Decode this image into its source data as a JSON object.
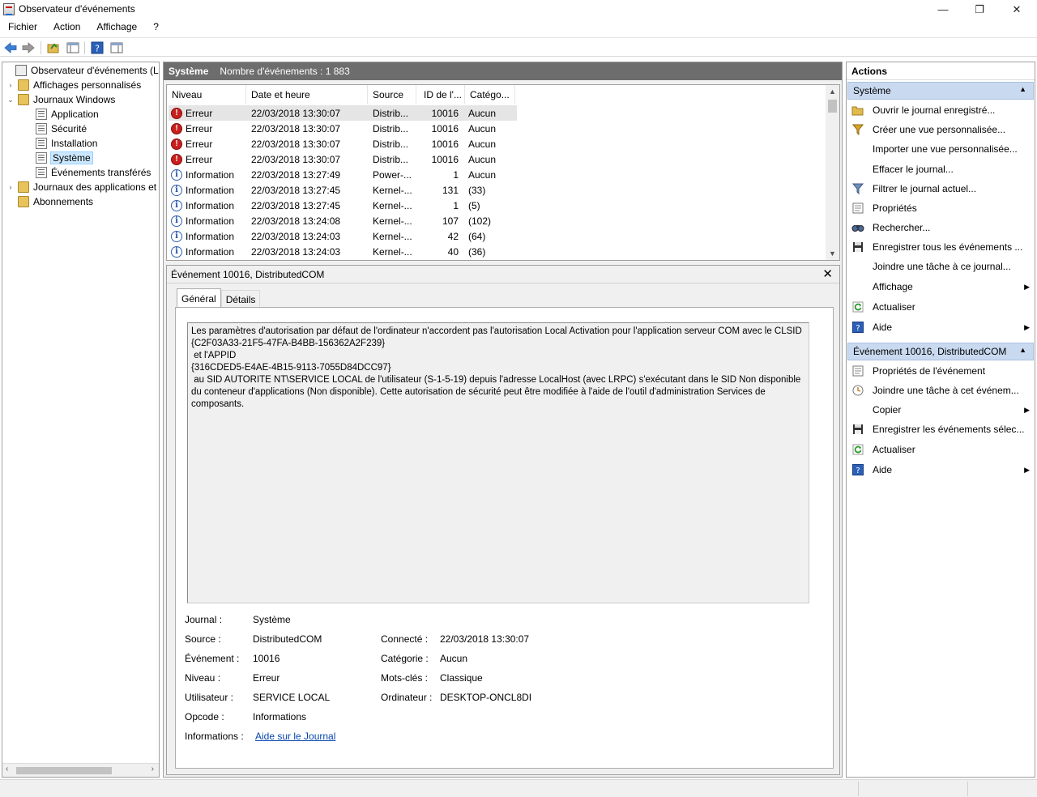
{
  "window": {
    "title": "Observateur d'événements",
    "controls": {
      "minimize": "—",
      "maximize": "❐",
      "close": "✕"
    }
  },
  "menu": [
    "Fichier",
    "Action",
    "Affichage",
    "?"
  ],
  "toolbar": {
    "icons": [
      "back-arrow-icon",
      "forward-arrow-icon",
      "open-folder-icon",
      "console-tree-icon",
      "help-icon",
      "action-pane-icon"
    ]
  },
  "tree": {
    "items": [
      {
        "label": "Observateur d'événements (Local)",
        "level": 0,
        "icon": "root"
      },
      {
        "label": "Affichages personnalisés",
        "level": 1,
        "icon": "folder",
        "expander": "›"
      },
      {
        "label": "Journaux Windows",
        "level": 1,
        "icon": "folder-open",
        "expander": "⌄"
      },
      {
        "label": "Application",
        "level": 2,
        "icon": "log"
      },
      {
        "label": "Sécurité",
        "level": 2,
        "icon": "log"
      },
      {
        "label": "Installation",
        "level": 2,
        "icon": "log"
      },
      {
        "label": "Système",
        "level": 2,
        "icon": "log",
        "selected": true
      },
      {
        "label": "Événements transférés",
        "level": 2,
        "icon": "log"
      },
      {
        "label": "Journaux des applications et",
        "level": 1,
        "icon": "folder",
        "expander": "›"
      },
      {
        "label": "Abonnements",
        "level": 1,
        "icon": "folder"
      }
    ]
  },
  "center": {
    "log_name": "Système",
    "event_count": "Nombre d'événements : 1 883",
    "columns": [
      "Niveau",
      "Date et heure",
      "Source",
      "ID de l'...",
      "Catégo..."
    ],
    "rows": [
      {
        "level": "Erreur",
        "type": "err",
        "date": "22/03/2018 13:30:07",
        "source": "Distrib...",
        "id": "10016",
        "category": "Aucun"
      },
      {
        "level": "Erreur",
        "type": "err",
        "date": "22/03/2018 13:30:07",
        "source": "Distrib...",
        "id": "10016",
        "category": "Aucun"
      },
      {
        "level": "Erreur",
        "type": "err",
        "date": "22/03/2018 13:30:07",
        "source": "Distrib...",
        "id": "10016",
        "category": "Aucun"
      },
      {
        "level": "Erreur",
        "type": "err",
        "date": "22/03/2018 13:30:07",
        "source": "Distrib...",
        "id": "10016",
        "category": "Aucun"
      },
      {
        "level": "Information",
        "type": "info",
        "date": "22/03/2018 13:27:49",
        "source": "Power-...",
        "id": "1",
        "category": "Aucun"
      },
      {
        "level": "Information",
        "type": "info",
        "date": "22/03/2018 13:27:45",
        "source": "Kernel-...",
        "id": "131",
        "category": "(33)"
      },
      {
        "level": "Information",
        "type": "info",
        "date": "22/03/2018 13:27:45",
        "source": "Kernel-...",
        "id": "1",
        "category": "(5)"
      },
      {
        "level": "Information",
        "type": "info",
        "date": "22/03/2018 13:24:08",
        "source": "Kernel-...",
        "id": "107",
        "category": "(102)"
      },
      {
        "level": "Information",
        "type": "info",
        "date": "22/03/2018 13:24:03",
        "source": "Kernel-...",
        "id": "42",
        "category": "(64)"
      },
      {
        "level": "Information",
        "type": "info",
        "date": "22/03/2018 13:24:03",
        "source": "Kernel-...",
        "id": "40",
        "category": "(36)"
      }
    ]
  },
  "detail": {
    "title": "Événement 10016, DistributedCOM",
    "close": "✕",
    "tabs": [
      "Général",
      "Détails"
    ],
    "description": "Les paramètres d'autorisation par défaut de l'ordinateur n'accordent pas l'autorisation Local Activation pour l'application serveur COM avec le CLSID\n{C2F03A33-21F5-47FA-B4BB-156362A2F239}\n et l'APPID\n{316CDED5-E4AE-4B15-9113-7055D84DCC97}\n au SID AUTORITE NT\\SERVICE LOCAL de l'utilisateur (S-1-5-19) depuis l'adresse LocalHost (avec LRPC) s'exécutant dans le SID Non disponible du conteneur d'applications (Non disponible). Cette autorisation de sécurité peut être modifiée à l'aide de l'outil d'administration Services de composants.",
    "props": {
      "journal_label": "Journal :",
      "journal": "Système",
      "source_label": "Source :",
      "source": "DistributedCOM",
      "event_label": "Événement :",
      "event": "10016",
      "level_label": "Niveau :",
      "level": "Erreur",
      "user_label": "Utilisateur :",
      "user": "SERVICE LOCAL",
      "opcode_label": "Opcode :",
      "opcode": "Informations",
      "info_label": "Informations :",
      "info_link": "Aide sur le Journal",
      "logged_label": "Connecté :",
      "logged": "22/03/2018 13:30:07",
      "category_label": "Catégorie :",
      "category": "Aucun",
      "keywords_label": "Mots-clés :",
      "keywords": "Classique",
      "computer_label": "Ordinateur :",
      "computer": "DESKTOP-ONCL8DI"
    }
  },
  "actions": {
    "title": "Actions",
    "section1": "Système",
    "section1_items": [
      {
        "label": "Ouvrir le journal enregistré...",
        "icon": "open-log-icon"
      },
      {
        "label": "Créer une vue personnalisée...",
        "icon": "filter-create-icon"
      },
      {
        "label": "Importer une vue personnalisée...",
        "icon": ""
      },
      {
        "label": "Effacer le journal...",
        "icon": ""
      },
      {
        "label": "Filtrer le journal actuel...",
        "icon": "filter-icon"
      },
      {
        "label": "Propriétés",
        "icon": "properties-icon"
      },
      {
        "label": "Rechercher...",
        "icon": "find-icon"
      },
      {
        "label": "Enregistrer tous les événements ...",
        "icon": "save-icon"
      },
      {
        "label": "Joindre une tâche à ce journal...",
        "icon": ""
      },
      {
        "label": "Affichage",
        "icon": "",
        "submenu": true
      },
      {
        "label": "Actualiser",
        "icon": "refresh-icon"
      },
      {
        "label": "Aide",
        "icon": "help-icon",
        "submenu": true
      }
    ],
    "section2": "Événement 10016, DistributedCOM",
    "section2_items": [
      {
        "label": "Propriétés de l'événement",
        "icon": "properties-icon"
      },
      {
        "label": "Joindre une tâche à cet événem...",
        "icon": "task-icon"
      },
      {
        "label": "Copier",
        "icon": "",
        "submenu": true
      },
      {
        "label": "Enregistrer les événements sélec...",
        "icon": "save-icon"
      },
      {
        "label": "Actualiser",
        "icon": "refresh-icon"
      },
      {
        "label": "Aide",
        "icon": "help-icon",
        "submenu": true
      }
    ]
  }
}
